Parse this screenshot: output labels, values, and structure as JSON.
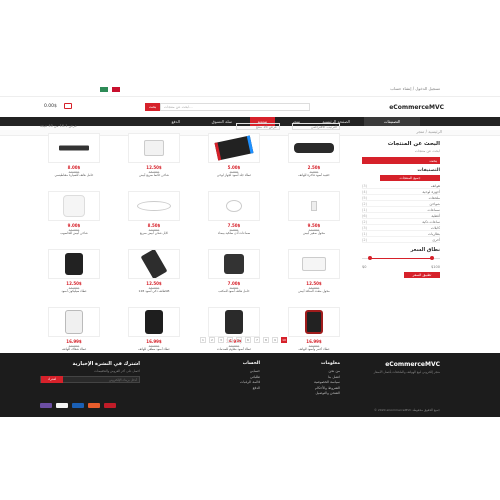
{
  "top": {
    "account": "تسجيل الدخول / إنشاء حساب"
  },
  "header": {
    "logo": "eCommerceMVC",
    "search_placeholder": "ابحث عن منتجات...",
    "search_button": "بحث",
    "cart_total": "0.00$"
  },
  "nav": {
    "categories": "التصنيفات",
    "items": [
      "الصفحة الرئيسية",
      "متجر",
      "مدونة",
      "سلة التسوق",
      "الدفع"
    ]
  },
  "breadcrumb": "الرئيسية / متجر",
  "sidebar": {
    "title": "البحث عن المنتجات",
    "subtitle": "ابحث عن منتجات",
    "header": "بحث",
    "categories_title": "التصنيفات",
    "active_category": "جميع المنتجات",
    "categories": [
      {
        "name": "هواتف",
        "count": "(3)"
      },
      {
        "name": "أجهزة لوحية",
        "count": "(4)"
      },
      {
        "name": "ملحقات",
        "count": "(5)"
      },
      {
        "name": "شواحن",
        "count": "(2)"
      },
      {
        "name": "سماعات",
        "count": "(1)"
      },
      {
        "name": "أغطية",
        "count": "(6)"
      },
      {
        "name": "ساعات ذكية",
        "count": "(2)"
      },
      {
        "name": "كابلات",
        "count": "(3)"
      },
      {
        "name": "بطاريات",
        "count": "(1)"
      },
      {
        "name": "أخرى",
        "count": "(2)"
      }
    ],
    "price_title": "نطاق السعر",
    "price_min": "$0",
    "price_max": "$100",
    "apply": "تطبيق السعر"
  },
  "toolbar": {
    "count": "عرض 1-16 من 40 نتيجة",
    "show": "عرض 16 منتج",
    "sort": "الترتيب الافتراضي"
  },
  "products": [
    {
      "price": "8.00$",
      "old": "10.00$",
      "name": "حامل هاتف للسيارة مغناطيسي"
    },
    {
      "price": "12.50$",
      "old": "15.00$",
      "name": "شاحن حائط سريع أبيض"
    },
    {
      "price": "5.00$",
      "old": "7.00$",
      "name": "غطاء جلد أسود لجهاز لوحي"
    },
    {
      "price": "2.50$",
      "old": "4.00$",
      "name": "حقيبة أسود فاخرة للهاتف"
    },
    {
      "price": "9.00$",
      "old": "11.00$",
      "name": "شاحن أبيض للحاسوب"
    },
    {
      "price": "8.50$",
      "old": "10.00$",
      "name": "كابل شحن أبيض سريع"
    },
    {
      "price": "7.50$",
      "old": "9.00$",
      "name": "سماعات أذن سلكية بيضاء"
    },
    {
      "price": "9.50$",
      "old": "12.00$",
      "name": "محول صغير أبيض"
    },
    {
      "price": "12.50$",
      "old": "14.00$",
      "name": "غطاء سيليكون أسود"
    },
    {
      "price": "12.50$",
      "old": "14.00$",
      "name": "هاتف ذكي أسود 128GB"
    },
    {
      "price": "7.00$",
      "old": "9.00$",
      "name": "حامل هاتف أسود للمكتب"
    },
    {
      "price": "12.50$",
      "old": "14.00$",
      "name": "محول متعدد المنافذ أبيض"
    },
    {
      "price": "16.99$",
      "old": "19.00$",
      "name": "غطاء شفاف للهاتف"
    },
    {
      "price": "16.99$",
      "old": "19.00$",
      "name": "غطاء أسود مطفي للهاتف"
    },
    {
      "price": "16.99$",
      "old": "19.00$",
      "name": "غطاء أسود مقاوم للصدمات"
    },
    {
      "price": "16.99$",
      "old": "19.00$",
      "name": "غطاء أحمر وأسود للهاتف"
    }
  ],
  "pager": [
    "1",
    "2",
    "3",
    "4",
    "5",
    "6",
    "7",
    "8",
    "9",
    "10"
  ],
  "footer": {
    "logo": "eCommerceMVC",
    "desc": "متجر إلكتروني لبيع الهواتف والملحقات بأفضل الأسعار",
    "col1_title": "معلومات",
    "col1": [
      "من نحن",
      "اتصل بنا",
      "سياسة الخصوصية",
      "الشروط والأحكام",
      "الشحن والتوصيل"
    ],
    "col2_title": "الحساب",
    "col2": [
      "حسابي",
      "طلباتي",
      "قائمة الرغبات",
      "الدفع"
    ],
    "news_title": "اشترك في النشرة الإخبارية",
    "news_desc": "احصل على آخر العروض والتخفيضات",
    "news_placeholder": "أدخل بريدك الإلكتروني",
    "news_button": "اشترك",
    "copyright": "© 2020 eCommerceMVC جميع الحقوق محفوظة"
  },
  "colors": {
    "accent": "#d6212a",
    "dark": "#222222",
    "footer": "#1c1c1c"
  }
}
